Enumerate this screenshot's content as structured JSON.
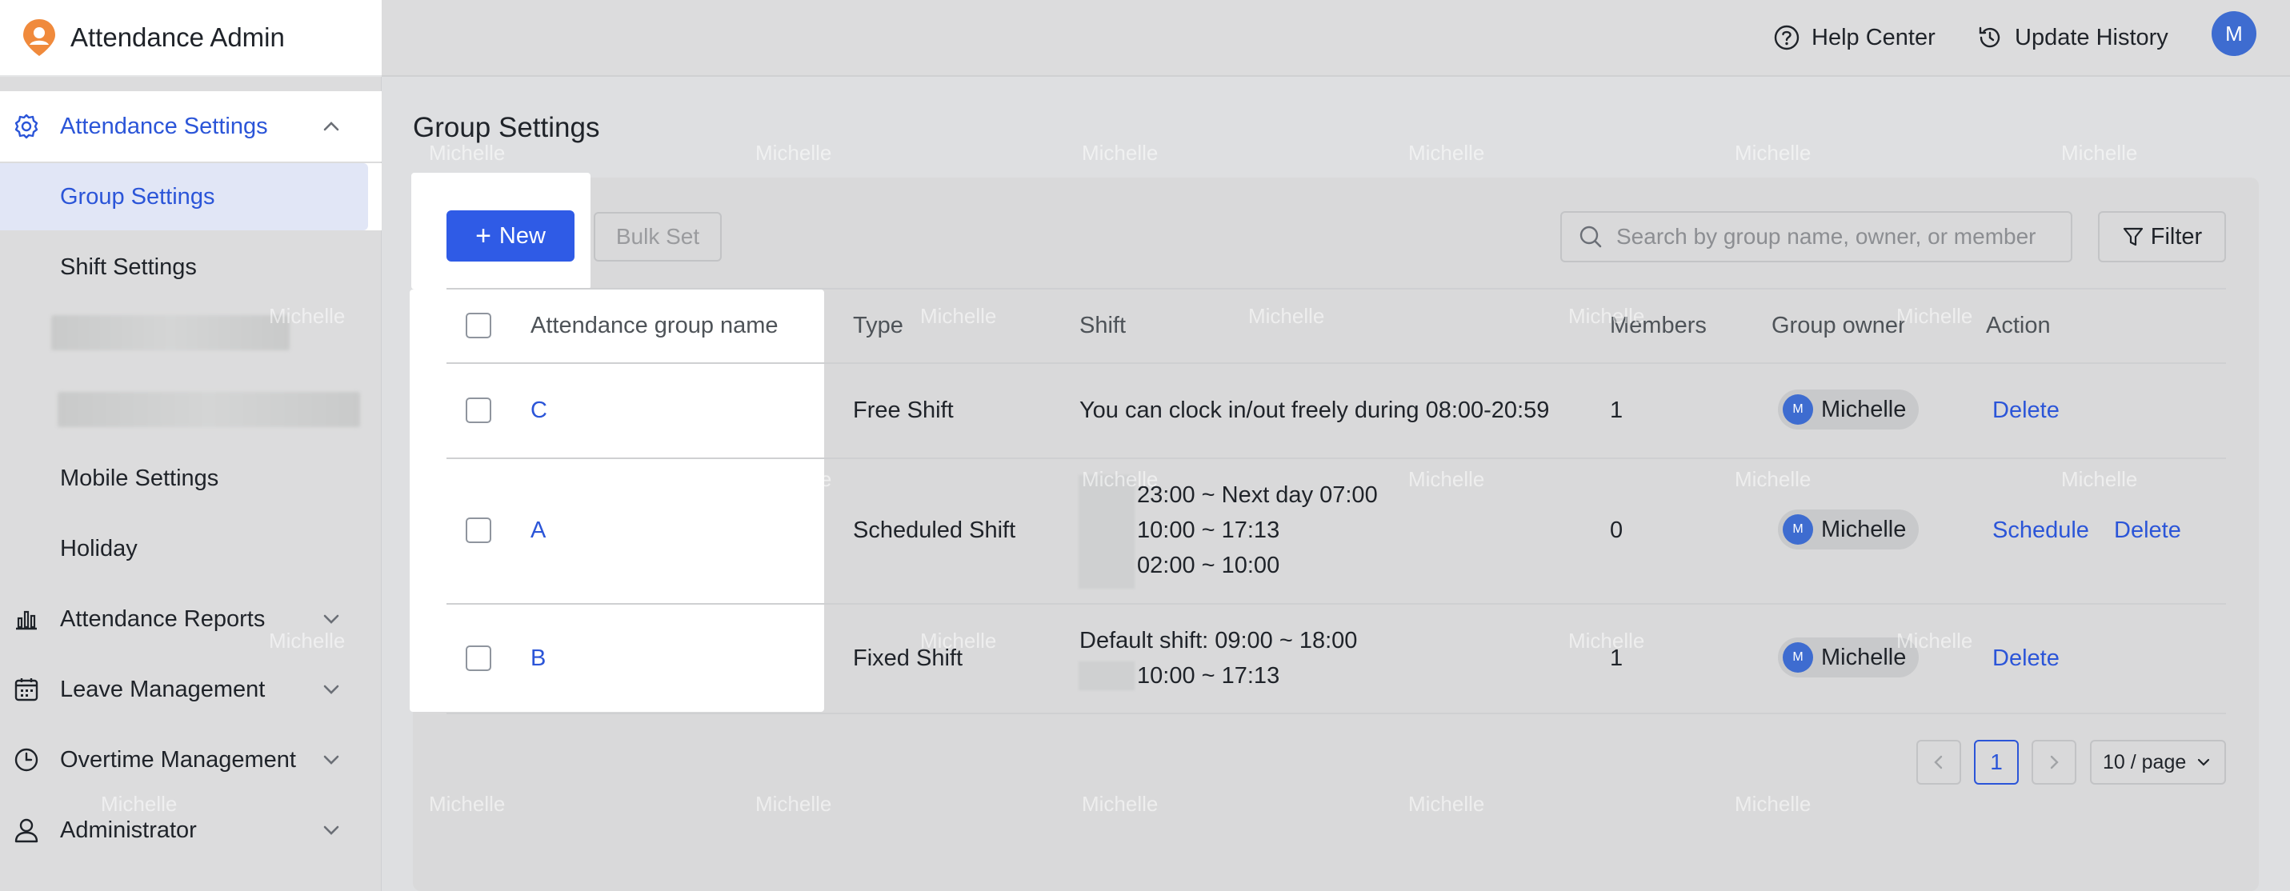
{
  "app": {
    "title": "Attendance Admin"
  },
  "topbar": {
    "help": "Help Center",
    "history": "Update History",
    "avatar_initial": "M"
  },
  "sidebar": {
    "settings_group": "Attendance Settings",
    "items": [
      "Group Settings",
      "Shift Settings",
      "Mobile Settings",
      "Holiday"
    ],
    "reports": "Attendance Reports",
    "leave": "Leave Management",
    "overtime": "Overtime Management",
    "admin": "Administrator"
  },
  "page": {
    "title": "Group Settings"
  },
  "toolbar": {
    "new_label": "New",
    "bulk_label": "Bulk Set",
    "search_placeholder": "Search by group name, owner, or member",
    "filter_label": "Filter"
  },
  "table": {
    "headers": [
      "Attendance group name",
      "Type",
      "Shift",
      "Members",
      "Group owner",
      "Action"
    ],
    "rows": [
      {
        "name": "C",
        "type": "Free Shift",
        "shift": [
          "You can clock in/out freely during 08:00-20:59"
        ],
        "members": "1",
        "owner": "Michelle",
        "owner_initial": "M",
        "actions": [
          "Delete"
        ]
      },
      {
        "name": "A",
        "type": "Scheduled Shift",
        "shift": [
          "23:00 ~ Next day 07:00",
          "10:00 ~ 17:13",
          "02:00 ~ 10:00"
        ],
        "members": "0",
        "owner": "Michelle",
        "owner_initial": "M",
        "actions": [
          "Schedule",
          "Delete"
        ]
      },
      {
        "name": "B",
        "type": "Fixed Shift",
        "shift": [
          "Default shift: 09:00 ~ 18:00",
          "10:00 ~ 17:13"
        ],
        "members": "1",
        "owner": "Michelle",
        "owner_initial": "M",
        "actions": [
          "Delete"
        ]
      }
    ]
  },
  "pagination": {
    "current": "1",
    "page_size": "10 / page"
  },
  "watermark": "Michelle",
  "colors": {
    "primary": "#2f5be6",
    "link": "#2b55d8",
    "overlay": "#dcdcdd"
  }
}
